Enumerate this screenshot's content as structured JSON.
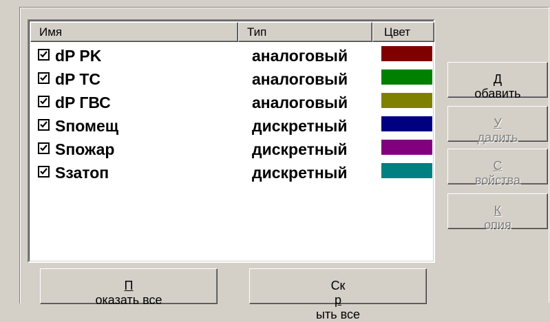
{
  "columns": {
    "name": "Имя",
    "type": "Тип",
    "color": "Цвет"
  },
  "rows": [
    {
      "name": "dP PK",
      "type": "аналоговый",
      "color": "#800000",
      "checked": true
    },
    {
      "name": "dP TC",
      "type": "аналоговый",
      "color": "#008000",
      "checked": true
    },
    {
      "name": "dP ГВС",
      "type": "аналоговый",
      "color": "#808000",
      "checked": true
    },
    {
      "name": "Sпомещ",
      "type": "дискретный",
      "color": "#000080",
      "checked": true
    },
    {
      "name": "Sпожар",
      "type": "дискретный",
      "color": "#800080",
      "checked": true
    },
    {
      "name": "Sзатоп",
      "type": "дискретный",
      "color": "#008080",
      "checked": true
    }
  ],
  "buttons": {
    "add": {
      "label": "Добавить",
      "mnemonic": "Д",
      "rest": "обавить",
      "enabled": true
    },
    "delete": {
      "label": "Удалить",
      "mnemonic": "У",
      "rest": "далить",
      "enabled": false
    },
    "props": {
      "label": "Свойства",
      "mnemonic": "С",
      "rest": "войства",
      "enabled": false
    },
    "copy": {
      "label": "Копия",
      "mnemonic": "К",
      "rest": "опия",
      "enabled": false
    },
    "show_all": {
      "label": "Показать все",
      "mnemonic": "П",
      "rest": "оказать все"
    },
    "hide_all": {
      "label": "Скрыть все",
      "pre": "Ск",
      "mnemonic": "р",
      "rest": "ыть все"
    }
  }
}
